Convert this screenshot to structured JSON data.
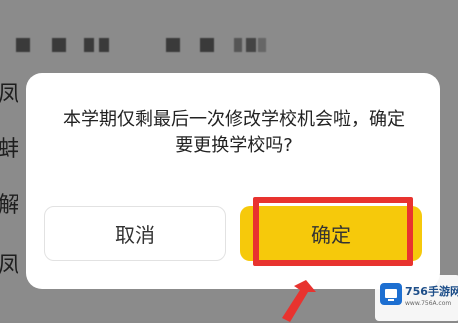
{
  "background": {
    "side_labels": [
      "凤",
      "蚌",
      "解",
      "凤"
    ]
  },
  "dialog": {
    "message_line1": "本学期仅剩最后一次修改学校机会啦，确定",
    "message_line2": "要更换学校吗?",
    "cancel_label": "取消",
    "confirm_label": "确定"
  },
  "watermark": {
    "title": "756手游网",
    "url": "www.756A.com"
  },
  "colors": {
    "confirm_bg": "#f6c90b",
    "highlight": "#e8332f",
    "overlay": "#8b8b8b"
  }
}
